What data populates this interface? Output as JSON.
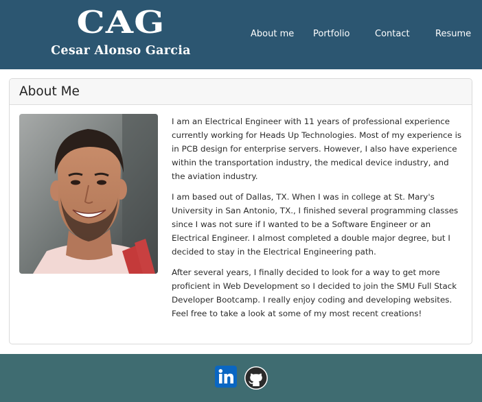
{
  "header": {
    "brand_mark": "CAG",
    "brand_name": "Cesar Alonso Garcia",
    "nav": [
      "About me",
      "Portfolio",
      "Contact",
      "Resume"
    ]
  },
  "about": {
    "title": "About Me",
    "paragraphs": [
      "I am an Electrical Engineer with 11 years of professional experience currently working for Heads Up Technologies. Most of my experience is in PCB design for enterprise servers. However, I also have experience within the transportation industry, the medical device industry, and the aviation industry.",
      "I am based out of Dallas, TX. When I was in college at St. Mary's University in San Antonio, TX., I finished several programming classes since I was not sure if I wanted to be a Software Engineer or an Electrical Engineer. I almost completed a double major degree, but I decided to stay in the Electrical Engineering path.",
      "After several years, I finally decided to look for a way to get more proficient in Web Development so I decided to join the SMU Full Stack Developer Bootcamp. I really enjoy coding and developing websites. Feel free to take a look at some of my most recent creations!"
    ]
  },
  "footer": {
    "icons": [
      "linkedin-icon",
      "github-icon"
    ]
  },
  "colors": {
    "header_bg": "#2c5671",
    "footer_bg": "#3f6c71",
    "linkedin": "#0a66c2",
    "github": "#2b2b2b"
  }
}
